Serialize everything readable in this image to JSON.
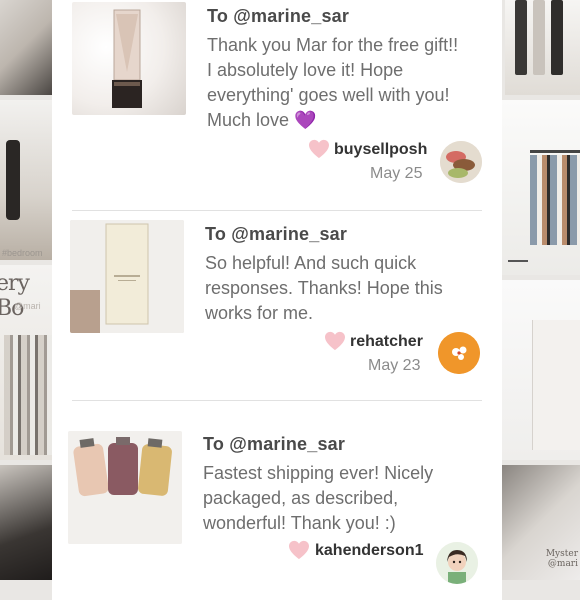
{
  "reviews": [
    {
      "to": "To @marine_sar",
      "message_lines": [
        "Thank you Mar for the free gift!!",
        "I absolutely love it! Hope",
        "everything' goes well with you!",
        "Much love 💜"
      ],
      "username": "buysellposh",
      "date": "May 25",
      "product_icon": "perfume-bottle-photo",
      "avatar_icon": "macaron-avatar"
    },
    {
      "to": "To @marine_sar",
      "message_lines": [
        "So helpful! And such quick",
        "responses. Thanks! Hope this",
        "works for me."
      ],
      "username": "rehatcher",
      "date": "May 23",
      "product_icon": "lotion-box-photo",
      "avatar_icon": "orange-avatar"
    },
    {
      "to": "To @marine_sar",
      "message_lines": [
        "Fastest shipping ever! Nicely",
        "packaged, as described,",
        "wonderful! Thank you! :)"
      ],
      "username": "kahenderson1",
      "date": "",
      "product_icon": "hand-sanitizer-photo",
      "avatar_icon": "girl-avatar"
    }
  ],
  "background": {
    "left_tag": "#bedroom",
    "left_big": "ery Bo",
    "left_small": "@mari",
    "right_caption": "Myster\n@mari"
  },
  "colors": {
    "heart": "#f6c2c9",
    "username": "#333333",
    "message": "#6e6e6e"
  }
}
